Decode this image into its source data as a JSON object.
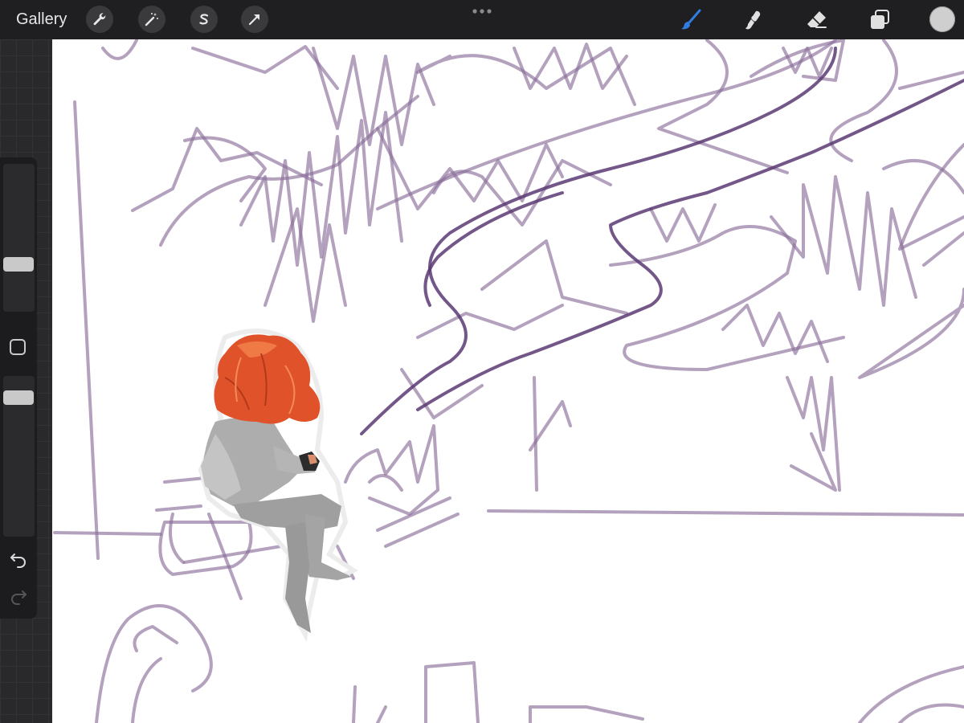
{
  "toolbar": {
    "gallery_label": "Gallery",
    "left_tools": [
      {
        "name": "actions",
        "icon": "wrench-icon"
      },
      {
        "name": "adjustments",
        "icon": "magic-wand-icon"
      },
      {
        "name": "selection",
        "icon": "selection-s-icon"
      },
      {
        "name": "transform",
        "icon": "arrow-cursor-icon"
      }
    ],
    "more_icon": "ellipsis-icon",
    "right_tools": [
      {
        "name": "brush",
        "icon": "brush-icon",
        "active": true
      },
      {
        "name": "smudge",
        "icon": "smudge-icon",
        "active": false
      },
      {
        "name": "eraser",
        "icon": "eraser-icon",
        "active": false
      },
      {
        "name": "layers",
        "icon": "layers-icon",
        "active": false
      }
    ],
    "current_color": "#cfcfcf"
  },
  "sidebar": {
    "brush_size_level": 0.3,
    "opacity_level": 0.9,
    "modify_icon": "square-icon",
    "undo_icon": "undo-icon",
    "redo_icon": "redo-icon"
  },
  "colors": {
    "accent_active_tool": "#2f7de1",
    "stroke_color": "#8a6f99",
    "hair_color": "#e0522a",
    "armor_color": "#a9a9a9"
  }
}
